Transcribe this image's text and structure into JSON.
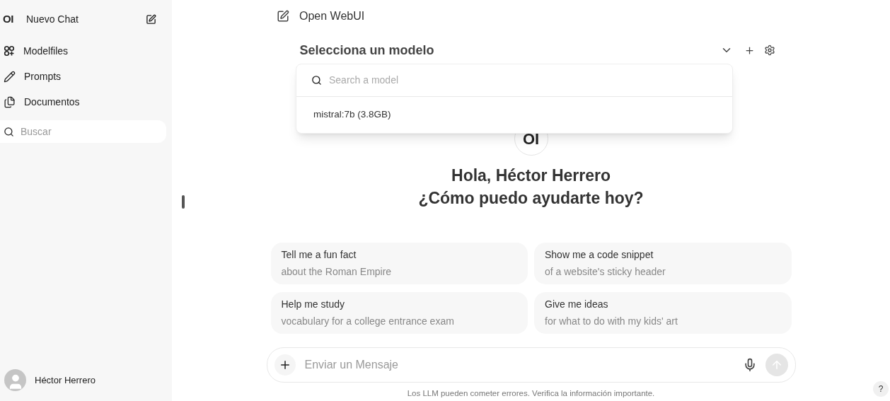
{
  "sidebar": {
    "logo": "OI",
    "new_chat": "Nuevo Chat",
    "items": [
      {
        "kind": "modelfiles",
        "label": "Modelfiles"
      },
      {
        "kind": "prompts",
        "label": "Prompts"
      },
      {
        "kind": "documents",
        "label": "Documentos"
      }
    ],
    "search": {
      "placeholder": "Buscar"
    },
    "user": {
      "name": "Héctor Herrero"
    }
  },
  "header": {
    "title": "Open WebUI"
  },
  "model_selector": {
    "label": "Selecciona un modelo",
    "dropdown": {
      "search": {
        "placeholder": "Search a model"
      },
      "options": [
        {
          "label": "mistral:7b (3.8GB)"
        }
      ]
    }
  },
  "welcome": {
    "logo": "OI",
    "greeting": "Hola, Héctor Herrero",
    "question": "¿Cómo puedo ayudarte hoy?"
  },
  "suggestions": [
    {
      "title": "Tell me a fun fact",
      "subtitle": "about the Roman Empire"
    },
    {
      "title": "Show me a code snippet",
      "subtitle": "of a website's sticky header"
    },
    {
      "title": "Help me study",
      "subtitle": "vocabulary for a college entrance exam"
    },
    {
      "title": "Give me ideas",
      "subtitle": "for what to do with my kids' art"
    }
  ],
  "composer": {
    "placeholder": "Enviar un Mensaje"
  },
  "disclaimer": "Los LLM pueden cometer errores. Verifica la información importante.",
  "help": "?"
}
